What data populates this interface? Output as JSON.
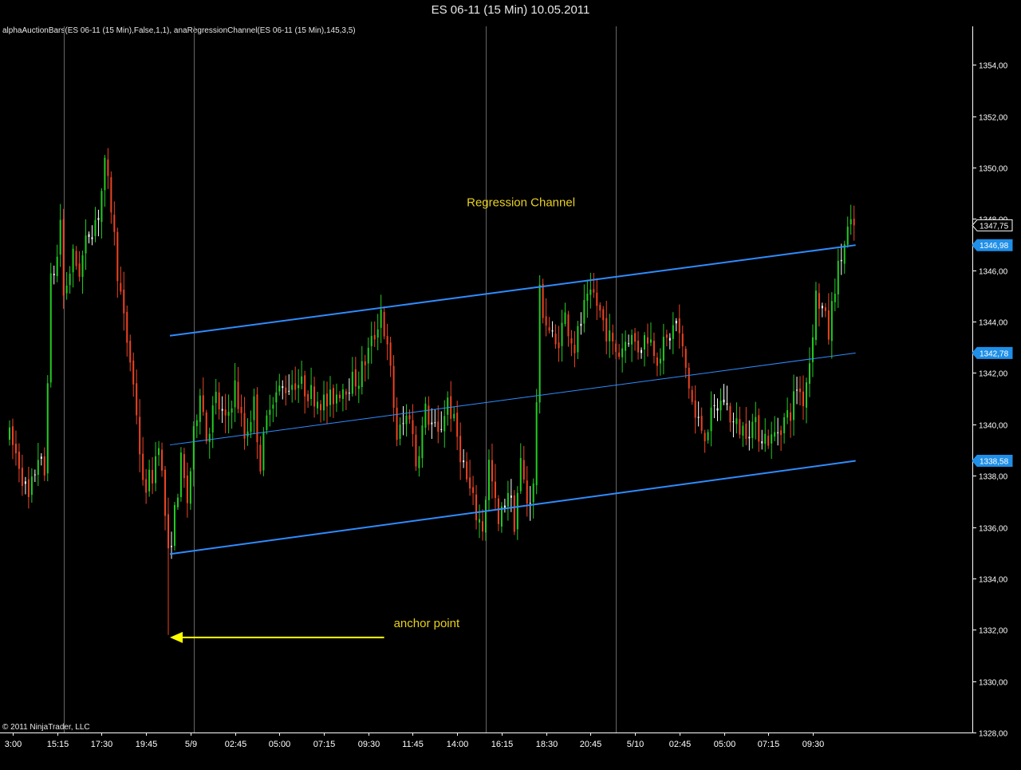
{
  "window": {
    "title": "ES 06-11 (15 Min)  10.05.2011",
    "indicator_label": "alphaAuctionBars(ES 06-11 (15 Min),False,1,1), anaRegressionChannel(ES 06-11 (15 Min),145,3,5)",
    "copyright": "© 2011 NinjaTrader, LLC"
  },
  "colors": {
    "background": "#000000",
    "up_candle": "#22cc22",
    "down_candle": "#ee4422",
    "doji": "#ffffff",
    "channel": "#2f8cff",
    "annotation": "#e8d020",
    "arrow": "#ffff00",
    "axis": "#ffffff",
    "grid": "#666666",
    "tag_fill": "#1f8fe8",
    "last_tag_fill": "#000000"
  },
  "chart_data": {
    "type": "candlestick",
    "instrument": "ES 06-11",
    "interval": "15 Min",
    "ylim": [
      1328,
      1355.5
    ],
    "y_ticks": [
      "1328,00",
      "1330,00",
      "1332,00",
      "1334,00",
      "1336,00",
      "1338,00",
      "1340,00",
      "1342,00",
      "1344,00",
      "1346,00",
      "1348,00",
      "1350,00",
      "1352,00",
      "1354,00"
    ],
    "y_tick_values": [
      1328,
      1330,
      1332,
      1334,
      1336,
      1338,
      1340,
      1342,
      1344,
      1346,
      1348,
      1350,
      1352,
      1354
    ],
    "x_ticks": [
      "3:00",
      "15:15",
      "17:30",
      "19:45",
      "5/9",
      "02:45",
      "05:00",
      "07:15",
      "09:30",
      "11:45",
      "14:00",
      "16:15",
      "18:30",
      "20:45",
      "5/10",
      "02:45",
      "05:00",
      "07:15",
      "09:30"
    ],
    "x_tick_bars": [
      1,
      15,
      29,
      43,
      57,
      71,
      85,
      99,
      113,
      127,
      141,
      155,
      169,
      183,
      197,
      211,
      225,
      239,
      253
    ],
    "session_breaks": [
      17,
      58,
      150,
      191
    ],
    "bar_count": 266,
    "regression_channel": {
      "period": 145,
      "start_bar": 50,
      "end_bar": 266,
      "upper": [
        1343.45,
        1346.98
      ],
      "middle": [
        1339.2,
        1342.78
      ],
      "lower": [
        1334.95,
        1338.58
      ]
    },
    "price_tags": [
      {
        "label": "1347,75",
        "value": 1347.75,
        "style": "last"
      },
      {
        "label": "1346,98",
        "value": 1346.98,
        "style": "channel"
      },
      {
        "label": "1342,78",
        "value": 1342.78,
        "style": "channel"
      },
      {
        "label": "1338,58",
        "value": 1338.58,
        "style": "channel"
      }
    ],
    "annotations": [
      {
        "text": "Regression Channel",
        "bar": 144,
        "value": 1348.5
      },
      {
        "text": "anchor point",
        "bar": 121,
        "value": 1332.1
      }
    ],
    "anchor": {
      "bar": 50,
      "value": 1331.8
    },
    "close_path": [
      [
        0,
        1339.5
      ],
      [
        3,
        1338.5
      ],
      [
        6,
        1337
      ],
      [
        9,
        1338.8
      ],
      [
        11,
        1338
      ],
      [
        12,
        1342
      ],
      [
        13,
        1345.5
      ],
      [
        15,
        1346.5
      ],
      [
        16,
        1348
      ],
      [
        17,
        1345
      ],
      [
        20,
        1346.5
      ],
      [
        22,
        1346
      ],
      [
        25,
        1347.5
      ],
      [
        28,
        1348.2
      ],
      [
        30,
        1350
      ],
      [
        32,
        1348.5
      ],
      [
        34,
        1346
      ],
      [
        36,
        1344
      ],
      [
        38,
        1342.5
      ],
      [
        40,
        1340.5
      ],
      [
        42,
        1337.5
      ],
      [
        45,
        1338
      ],
      [
        47,
        1339.5
      ],
      [
        49,
        1336.5
      ],
      [
        50,
        1334.8
      ],
      [
        52,
        1336.5
      ],
      [
        54,
        1338.5
      ],
      [
        56,
        1337
      ],
      [
        58,
        1339.5
      ],
      [
        60,
        1341.5
      ],
      [
        62,
        1339.5
      ],
      [
        65,
        1341
      ],
      [
        68,
        1340
      ],
      [
        71,
        1341.5
      ],
      [
        74,
        1339.5
      ],
      [
        77,
        1340.8
      ],
      [
        79,
        1338.5
      ],
      [
        82,
        1341
      ],
      [
        85,
        1341.3
      ],
      [
        90,
        1341.7
      ],
      [
        95,
        1341.2
      ],
      [
        100,
        1340.8
      ],
      [
        105,
        1341.5
      ],
      [
        110,
        1341.8
      ],
      [
        115,
        1343.5
      ],
      [
        117,
        1344.5
      ],
      [
        120,
        1342
      ],
      [
        122,
        1339.5
      ],
      [
        126,
        1340.5
      ],
      [
        128,
        1338.5
      ],
      [
        131,
        1340.5
      ],
      [
        135,
        1339.5
      ],
      [
        138,
        1341
      ],
      [
        141,
        1339.5
      ],
      [
        144,
        1337.8
      ],
      [
        147,
        1336.5
      ],
      [
        149,
        1336
      ],
      [
        151,
        1338.5
      ],
      [
        154,
        1336
      ],
      [
        157,
        1337.5
      ],
      [
        159,
        1336.2
      ],
      [
        161,
        1338.5
      ],
      [
        163,
        1337
      ],
      [
        165,
        1337.5
      ],
      [
        166,
        1341
      ],
      [
        167,
        1345
      ],
      [
        169,
        1344
      ],
      [
        172,
        1343
      ],
      [
        175,
        1344.2
      ],
      [
        178,
        1343
      ],
      [
        181,
        1344.5
      ],
      [
        184,
        1345
      ],
      [
        187,
        1344
      ],
      [
        190,
        1343
      ],
      [
        192,
        1342.8
      ],
      [
        195,
        1343.5
      ],
      [
        198,
        1343
      ],
      [
        201,
        1343.5
      ],
      [
        204,
        1342.7
      ],
      [
        207,
        1343.2
      ],
      [
        210,
        1344
      ],
      [
        212,
        1342.8
      ],
      [
        214,
        1341.5
      ],
      [
        216,
        1340.2
      ],
      [
        219,
        1339.7
      ],
      [
        222,
        1340.5
      ],
      [
        225,
        1341
      ],
      [
        228,
        1340
      ],
      [
        231,
        1339.8
      ],
      [
        234,
        1340
      ],
      [
        237,
        1339.6
      ],
      [
        240,
        1339.4
      ],
      [
        243,
        1340
      ],
      [
        246,
        1340.5
      ],
      [
        248,
        1341.5
      ],
      [
        250,
        1341
      ],
      [
        252,
        1342.5
      ],
      [
        254,
        1345
      ],
      [
        256,
        1344.5
      ],
      [
        258,
        1343.5
      ],
      [
        260,
        1345.5
      ],
      [
        262,
        1346.5
      ],
      [
        264,
        1347.5
      ],
      [
        266,
        1347.75
      ]
    ]
  }
}
